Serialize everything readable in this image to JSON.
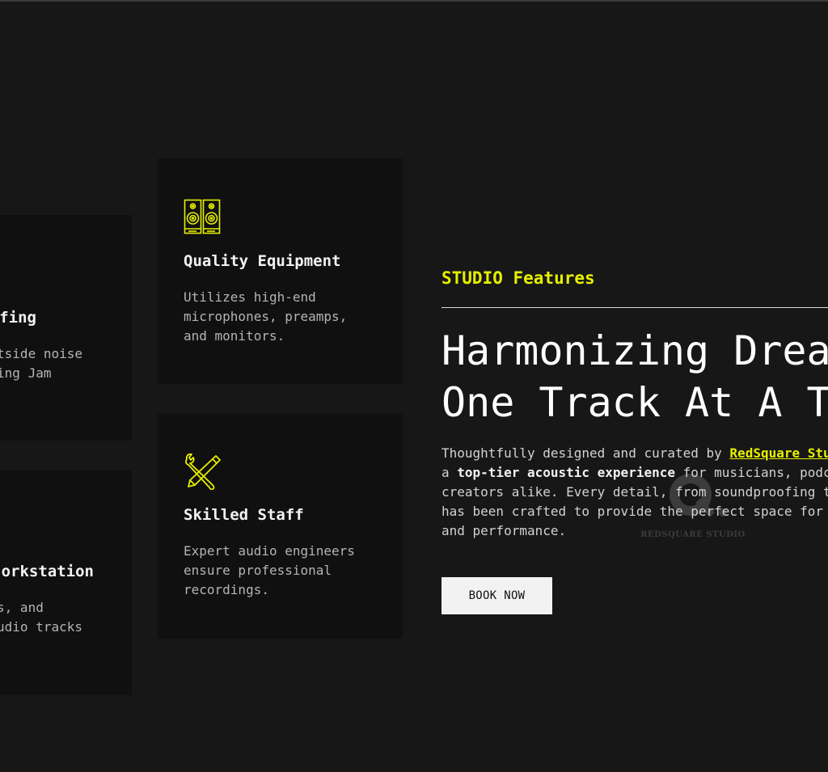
{
  "cards_left": [
    {
      "title": "ofing",
      "desc_lines": [
        "tside noise",
        "ing Jam"
      ]
    },
    {
      "title": "orkstation",
      "desc_lines": [
        "s, and",
        "udio tracks"
      ]
    }
  ],
  "cards": [
    {
      "icon": "speakers-icon",
      "title": "Quality Equipment",
      "desc_lines": [
        "Utilizes high-end",
        "microphones, preamps,",
        "and monitors."
      ]
    },
    {
      "icon": "tools-icon",
      "title": "Skilled Staff",
      "desc_lines": [
        "Expert audio engineers",
        "ensure professional",
        "recordings."
      ]
    }
  ],
  "section": {
    "eyebrow": "STUDIO Features",
    "heading_lines": [
      "Harmonizing Dreams,",
      "One Track At A Time"
    ],
    "body": {
      "l1_pre": "Thoughtfully designed and curated by ",
      "l1_link": "RedSquare Studio",
      "l2_pre": "a ",
      "l2_strong": "top-tier acoustic experience",
      "l2_post": " for musicians, podcasters and",
      "l3": "creators alike. Every detail, from soundproofing to equipment,",
      "l4": "has been crafted to provide the perfect space for creativity",
      "l5": "and performance."
    },
    "watermark": "REDSQUARE STUDIO",
    "cta_label": "BOOK NOW"
  },
  "colors": {
    "accent": "#e6f000",
    "background": "#171717",
    "card": "#101010"
  }
}
